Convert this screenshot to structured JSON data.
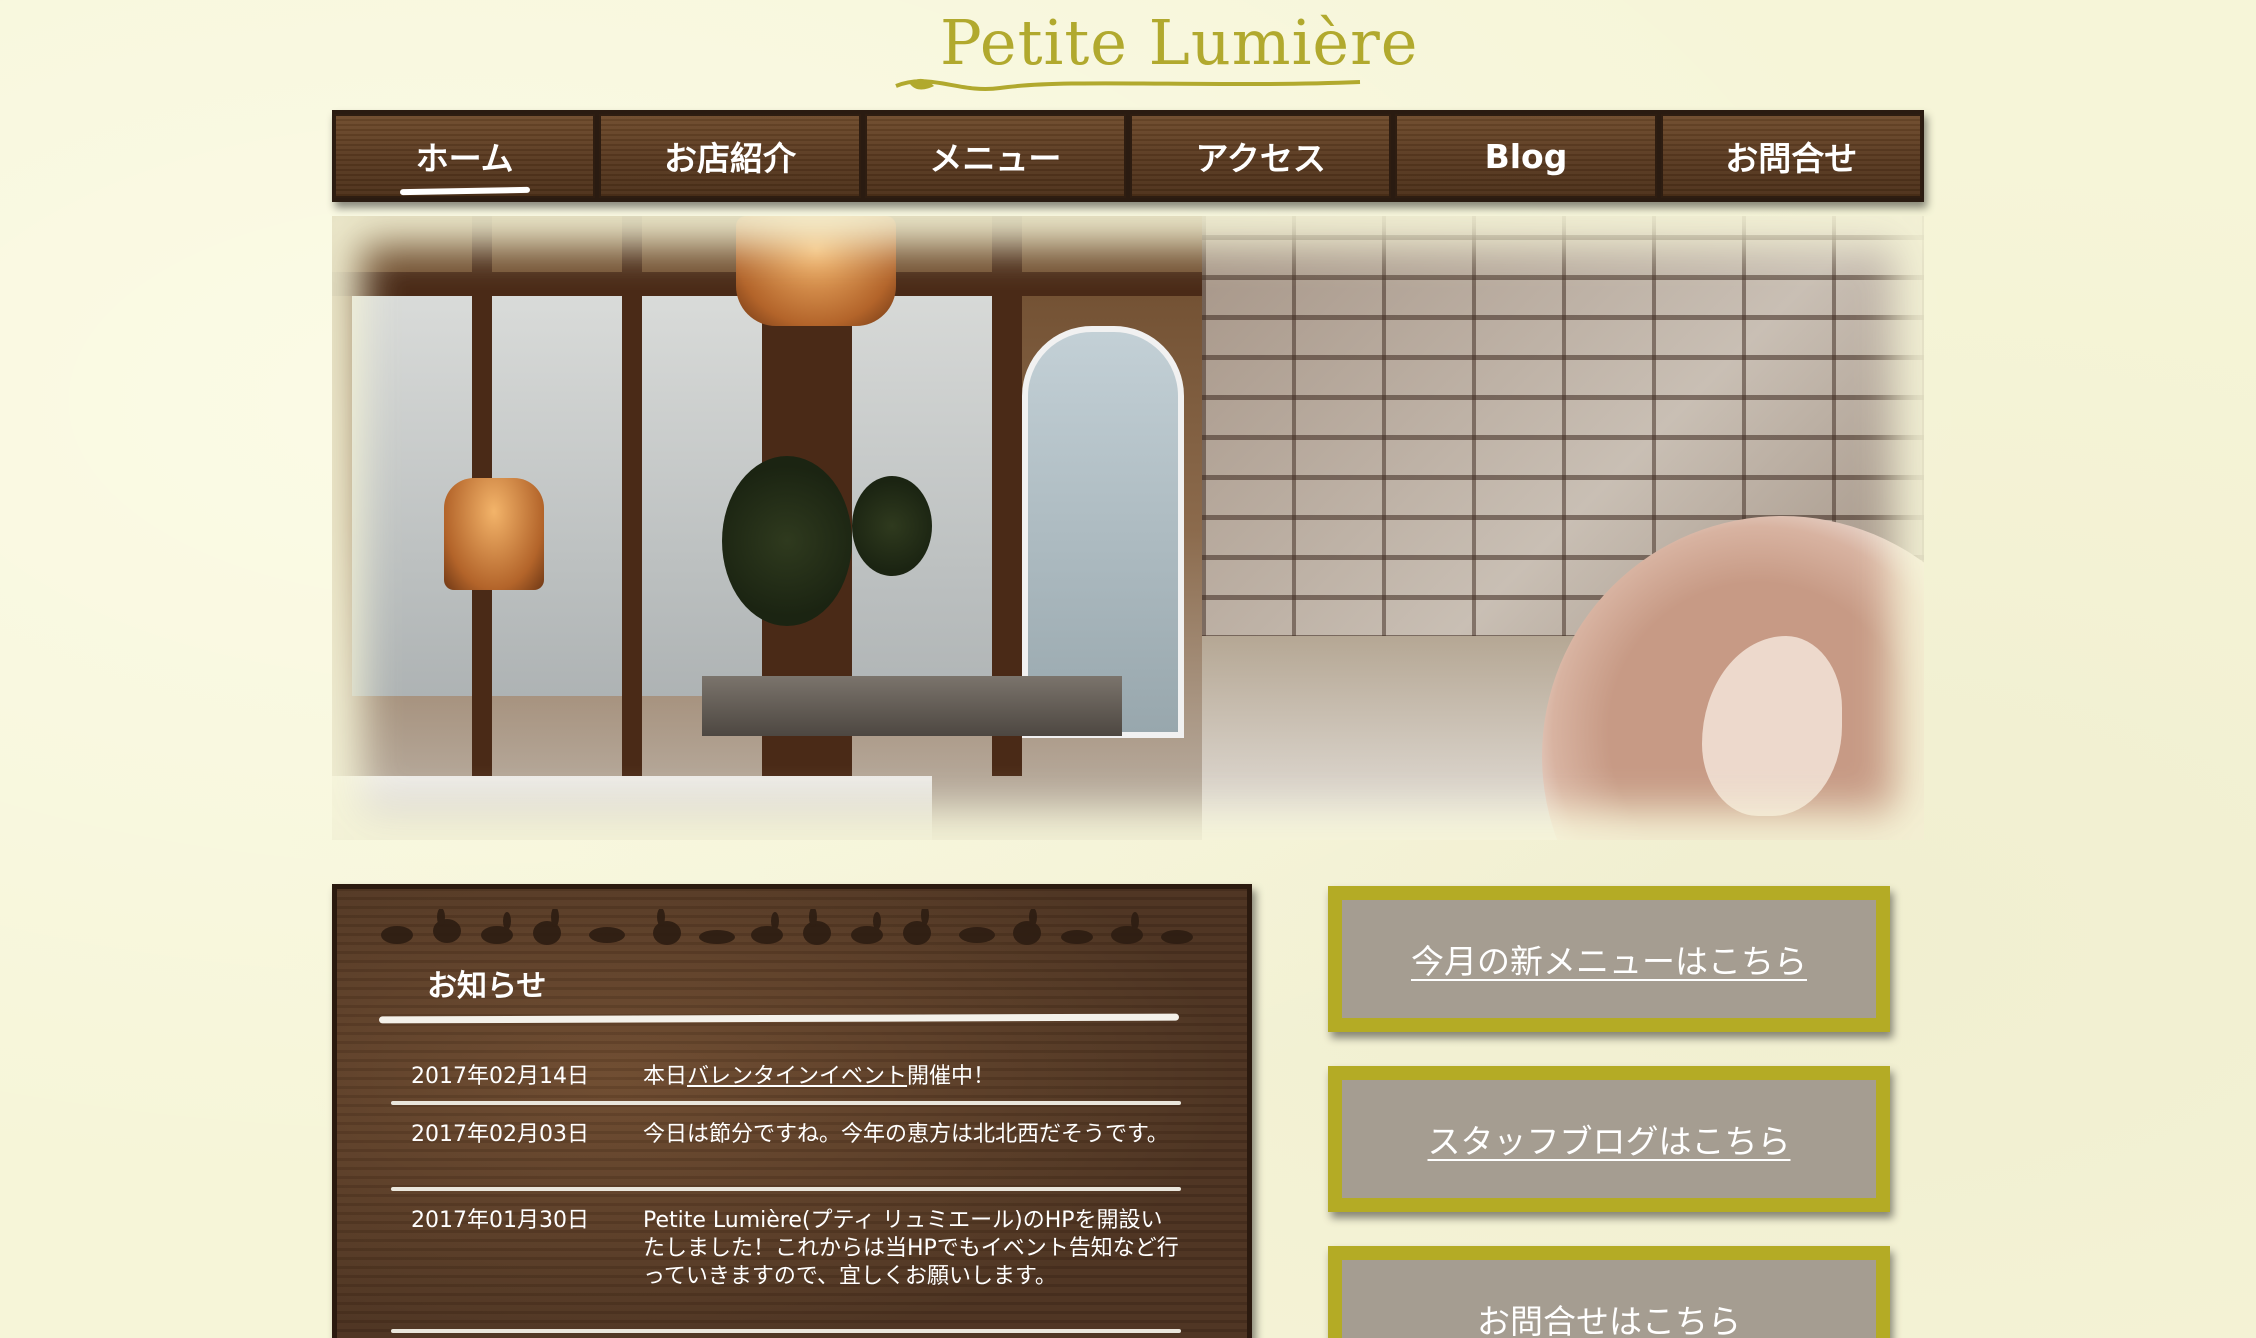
{
  "header": {
    "logo_text": "Petite Lumière"
  },
  "nav": {
    "items": [
      {
        "label": "ホーム",
        "active": true
      },
      {
        "label": "お店紹介"
      },
      {
        "label": "メニュー"
      },
      {
        "label": "アクセス"
      },
      {
        "label": "Blog"
      },
      {
        "label": "お問合せ"
      }
    ]
  },
  "news": {
    "title": "お知らせ",
    "items": [
      {
        "date": "2017年02月14日",
        "pre": "本日",
        "link": "バレンタインイベント",
        "post": "開催中！"
      },
      {
        "date": "2017年02月03日",
        "text": "今日は節分ですね。今年の恵方は北北西だそうです。"
      },
      {
        "date": "2017年01月30日",
        "text": "Petite Lumière(プティ リュミエール)のHPを開設いたしました！これからは当HPでもイベント告知など行っていきますので、宜しくお願いします。"
      }
    ]
  },
  "side": {
    "new_menu": "今月の新メニューはこちら",
    "staff_blog": "スタッフブログはこちら",
    "contact": "お問合せはこちら"
  },
  "colors": {
    "background": "#f6f5d8",
    "accent": "#b4ab25",
    "wood": "#5a3a20",
    "button_fill": "#a59d91"
  }
}
